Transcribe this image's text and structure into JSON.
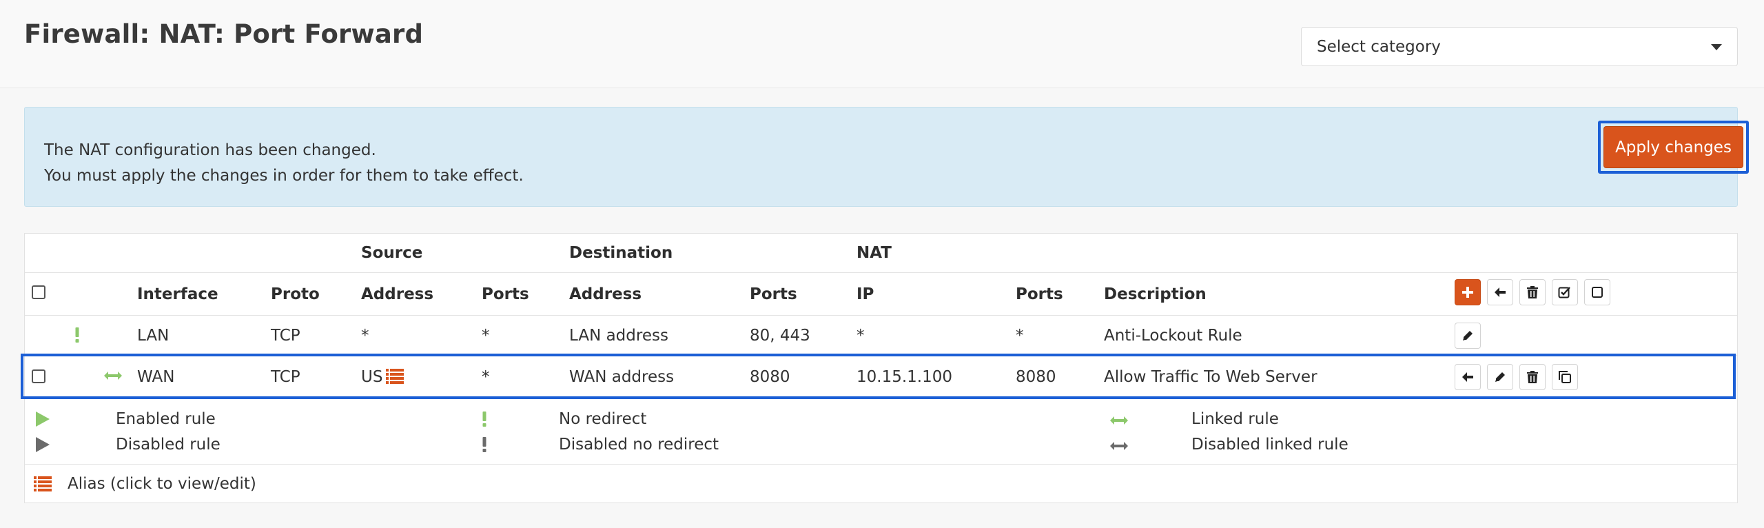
{
  "page": {
    "title": "Firewall: NAT: Port Forward"
  },
  "category_select": {
    "value": "Select category"
  },
  "alert": {
    "line1": "The NAT configuration has been changed.",
    "line2": "You must apply the changes in order for them to take effect.",
    "apply_label": "Apply changes"
  },
  "table": {
    "group_headers": {
      "source": "Source",
      "destination": "Destination",
      "nat": "NAT"
    },
    "columns": {
      "interface": "Interface",
      "proto": "Proto",
      "src_address": "Address",
      "src_ports": "Ports",
      "dst_address": "Address",
      "dst_ports": "Ports",
      "nat_ip": "IP",
      "nat_ports": "Ports",
      "description": "Description"
    },
    "rows": [
      {
        "interface": "LAN",
        "proto": "TCP",
        "src_address": "*",
        "src_ports": "*",
        "dst_address": "LAN address",
        "dst_ports": "80, 443",
        "nat_ip": "*",
        "nat_ports": "*",
        "description": "Anti-Lockout Rule",
        "status_icon": "no-redirect-icon"
      },
      {
        "interface": "WAN",
        "proto": "TCP",
        "src_address": "US",
        "src_ports": "*",
        "dst_address": "WAN address",
        "dst_ports": "8080",
        "nat_ip": "10.15.1.100",
        "nat_ports": "8080",
        "description": "Allow Traffic To Web Server",
        "status_icon": "linked-rule-icon"
      }
    ]
  },
  "legend": {
    "enabled_rule": "Enabled rule",
    "disabled_rule": "Disabled rule",
    "no_redirect": "No redirect",
    "disabled_no_redirect": "Disabled no redirect",
    "linked_rule": "Linked rule",
    "disabled_linked_rule": "Disabled linked rule",
    "alias": "Alias (click to view/edit)"
  },
  "colors": {
    "accent": "#d9541c",
    "enabled": "#8cc86b",
    "disabled": "#6b6b6b",
    "highlight": "#1c5fd6",
    "alert_bg": "#d9ebf5"
  }
}
